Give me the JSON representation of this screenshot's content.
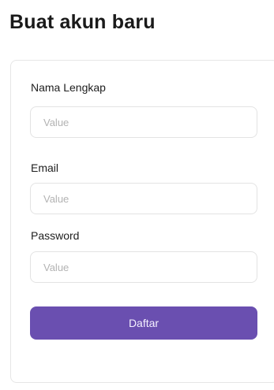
{
  "page": {
    "title": "Buat akun baru"
  },
  "form": {
    "fields": [
      {
        "label": "Nama Lengkap",
        "placeholder": "Value",
        "value": ""
      },
      {
        "label": "Email",
        "placeholder": "Value",
        "value": ""
      },
      {
        "label": "Password",
        "placeholder": "Value",
        "value": ""
      }
    ],
    "submit_label": "Daftar"
  },
  "colors": {
    "accent": "#6a4fb0",
    "border": "#e3e3e3",
    "placeholder": "#b3b3b3"
  }
}
